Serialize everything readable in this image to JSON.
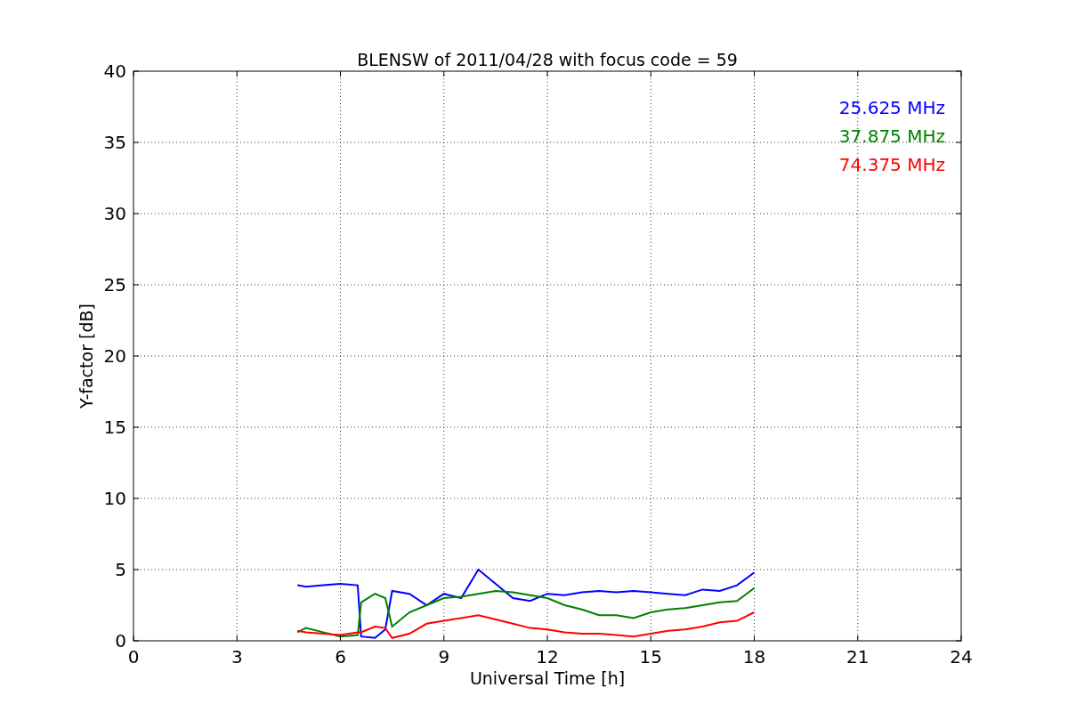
{
  "chart_data": {
    "type": "line",
    "title": "BLENSW of 2011/04/28 with focus code = 59",
    "xlabel": "Universal Time [h]",
    "ylabel": "Y-factor [dB]",
    "x": [
      4.75,
      5,
      5.5,
      6,
      6.5,
      6.6,
      7,
      7.3,
      7.5,
      8,
      8.5,
      9,
      9.5,
      10,
      10.5,
      11,
      11.5,
      12,
      12.5,
      13,
      13.5,
      14,
      14.5,
      15,
      15.5,
      16,
      16.5,
      17,
      17.5,
      18
    ],
    "series": [
      {
        "name": "25.625 MHz",
        "color": "#0000ff",
        "values": [
          3.9,
          3.8,
          3.9,
          4.0,
          3.9,
          0.3,
          0.2,
          0.8,
          3.5,
          3.3,
          2.5,
          3.3,
          3.0,
          5.0,
          4.0,
          3.0,
          2.8,
          3.3,
          3.2,
          3.4,
          3.5,
          3.4,
          3.5,
          3.4,
          3.3,
          3.2,
          3.6,
          3.5,
          3.9,
          4.8
        ]
      },
      {
        "name": "37.875 MHz",
        "color": "#008000",
        "values": [
          0.6,
          0.9,
          0.6,
          0.3,
          0.4,
          2.7,
          3.3,
          3.0,
          1.0,
          2.0,
          2.5,
          3.0,
          3.1,
          3.3,
          3.5,
          3.4,
          3.2,
          3.0,
          2.5,
          2.2,
          1.8,
          1.8,
          1.6,
          2.0,
          2.2,
          2.3,
          2.5,
          2.7,
          2.8,
          3.7
        ]
      },
      {
        "name": "74.375 MHz",
        "color": "#ff0000",
        "values": [
          0.7,
          0.6,
          0.5,
          0.4,
          0.6,
          0.6,
          1.0,
          0.9,
          0.2,
          0.5,
          1.2,
          1.4,
          1.6,
          1.8,
          1.5,
          1.2,
          0.9,
          0.8,
          0.6,
          0.5,
          0.5,
          0.4,
          0.3,
          0.5,
          0.7,
          0.8,
          1.0,
          1.3,
          1.4,
          2.0
        ]
      }
    ],
    "grid": true,
    "xlim": [
      0,
      24
    ],
    "ylim": [
      0,
      40
    ],
    "xticks": [
      0,
      3,
      6,
      9,
      12,
      15,
      18,
      21,
      24
    ],
    "yticks": [
      0,
      5,
      10,
      15,
      20,
      25,
      30,
      35,
      40
    ]
  }
}
